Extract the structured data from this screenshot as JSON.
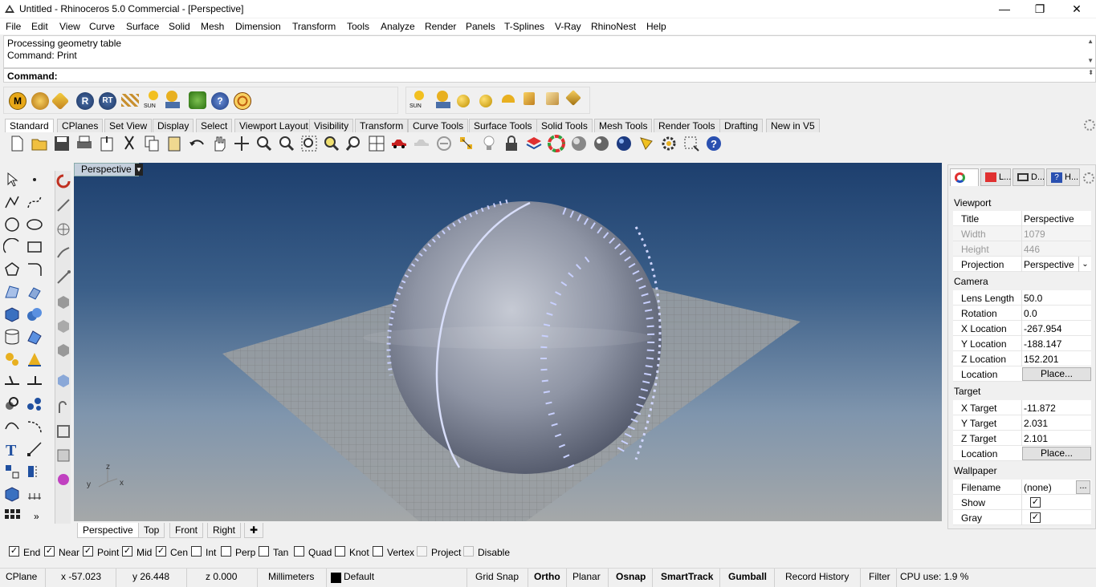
{
  "window": {
    "title": "Untitled - Rhinoceros 5.0 Commercial - [Perspective]"
  },
  "menu": [
    "File",
    "Edit",
    "View",
    "Curve",
    "Surface",
    "Solid",
    "Mesh",
    "Dimension",
    "Transform",
    "Tools",
    "Analyze",
    "Render",
    "Panels",
    "T-Splines",
    "V-Ray",
    "RhinoNest",
    "Help"
  ],
  "command": {
    "history": [
      "Processing geometry table",
      "Command: Print"
    ],
    "prompt": "Command:"
  },
  "render_toolbar": {
    "sun_label": "SUN",
    "icons": [
      "m-icon",
      "material-icon",
      "tag-icon",
      "r-icon",
      "rt-icon",
      "flames-icon",
      "sun-icon",
      "light-icon",
      "tree-icon",
      "help-icon",
      "target-icon"
    ]
  },
  "render_toolbar2": {
    "sun_label": "SUN"
  },
  "toolbar_tabs": [
    "Standard",
    "CPlanes",
    "Set View",
    "Display",
    "Select",
    "Viewport Layout",
    "Visibility",
    "Transform",
    "Curve Tools",
    "Surface Tools",
    "Solid Tools",
    "Mesh Tools",
    "Render Tools",
    "Drafting",
    "New in V5"
  ],
  "viewport": {
    "title": "Perspective",
    "axes": {
      "x": "x",
      "y": "y",
      "z": "z"
    },
    "tabs": [
      "Perspective",
      "Top",
      "Front",
      "Right"
    ]
  },
  "panel": {
    "tabs": [
      "L...",
      "D...",
      "H..."
    ],
    "viewport_header": "Viewport",
    "viewport": [
      {
        "k": "Title",
        "v": "Perspective"
      },
      {
        "k": "Width",
        "v": "1079"
      },
      {
        "k": "Height",
        "v": "446"
      },
      {
        "k": "Projection",
        "v": "Perspective"
      }
    ],
    "camera_header": "Camera",
    "camera": [
      {
        "k": "Lens Length",
        "v": "50.0"
      },
      {
        "k": "Rotation",
        "v": "0.0"
      },
      {
        "k": "X Location",
        "v": "-267.954"
      },
      {
        "k": "Y Location",
        "v": "-188.147"
      },
      {
        "k": "Z Location",
        "v": "152.201"
      },
      {
        "k": "Location",
        "v": "Place..."
      }
    ],
    "target_header": "Target",
    "target": [
      {
        "k": "X Target",
        "v": "-11.872"
      },
      {
        "k": "Y Target",
        "v": "2.031"
      },
      {
        "k": "Z Target",
        "v": "2.101"
      },
      {
        "k": "Location",
        "v": "Place..."
      }
    ],
    "wallpaper_header": "Wallpaper",
    "wallpaper": [
      {
        "k": "Filename",
        "v": "(none)"
      },
      {
        "k": "Show",
        "v": "✓"
      },
      {
        "k": "Gray",
        "v": "✓"
      }
    ],
    "browse": "..."
  },
  "osnap": [
    {
      "label": "End",
      "checked": true
    },
    {
      "label": "Near",
      "checked": true
    },
    {
      "label": "Point",
      "checked": true
    },
    {
      "label": "Mid",
      "checked": true
    },
    {
      "label": "Cen",
      "checked": true
    },
    {
      "label": "Int",
      "checked": false
    },
    {
      "label": "Perp",
      "checked": false
    },
    {
      "label": "Tan",
      "checked": false
    },
    {
      "label": "Quad",
      "checked": false
    },
    {
      "label": "Knot",
      "checked": false
    },
    {
      "label": "Vertex",
      "checked": false
    },
    {
      "label": "Project",
      "checked": false
    },
    {
      "label": "Disable",
      "checked": false
    }
  ],
  "status": {
    "cplane": "CPlane",
    "x": "x -57.023",
    "y": "y 26.448",
    "z": "z 0.000",
    "units": "Millimeters",
    "layer": "Default",
    "grid_snap": "Grid Snap",
    "ortho": "Ortho",
    "planar": "Planar",
    "osnap": "Osnap",
    "smarttrack": "SmartTrack",
    "gumball": "Gumball",
    "record_history": "Record History",
    "filter": "Filter",
    "cpu": "CPU use: 1.9 %"
  },
  "colors": {
    "viewport_top": "#1d3f6e",
    "viewport_bottom": "#a5a8a9",
    "ball": "#9aa0b0",
    "stitch": "#c8d0ff"
  }
}
